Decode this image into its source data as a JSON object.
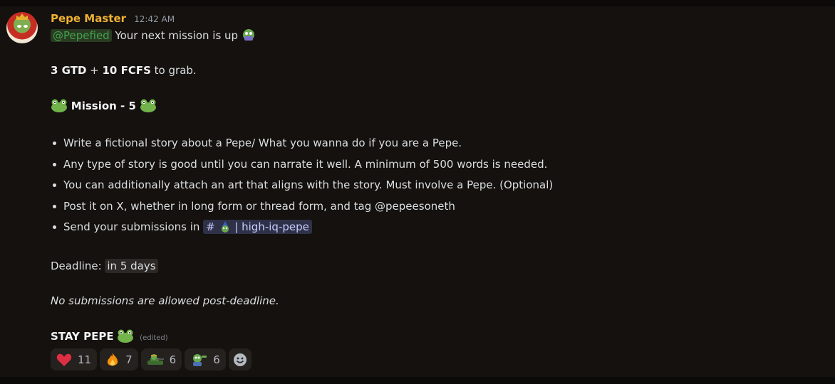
{
  "author": {
    "name": "Pepe Master",
    "time": "12:42 AM"
  },
  "message": {
    "mention": "@Pepefied",
    "intro": " Your next mission is up",
    "reward": {
      "gtd": "3 GTD",
      "plus": " + ",
      "fcfs": "10 FCFS",
      "suffix": " to grab."
    },
    "mission_title": "Mission - 5",
    "tasks": [
      "Write a fictional story about a Pepe/ What you wanna do if you are a Pepe.",
      "Any type of story is good until you can narrate it well. A minimum of 500 words is needed.",
      "You can additionally attach an art that aligns with the story. Must involve a Pepe. (Optional)",
      "Post it on X, whether in long form or thread form, and tag @pepeesoneth",
      "Send your submissions in "
    ],
    "channel": {
      "hash": "#",
      "name": "| high-iq-pepe"
    },
    "deadline_label": "Deadline: ",
    "deadline_value": "in 5 days",
    "note": "No submissions are allowed post-deadline.",
    "signoff": "STAY PEPE",
    "edited": "(edited)"
  },
  "reactions": [
    {
      "icon": "heart-icon",
      "count": "11"
    },
    {
      "icon": "fire-icon",
      "count": "7"
    },
    {
      "icon": "pepe-tank-icon",
      "count": "6"
    },
    {
      "icon": "pepe-dance-icon",
      "count": "6"
    }
  ],
  "colors": {
    "username": "#f0b232",
    "mention": "#3fa34d",
    "channel": "#c9cdfb",
    "background": "#14110e"
  }
}
